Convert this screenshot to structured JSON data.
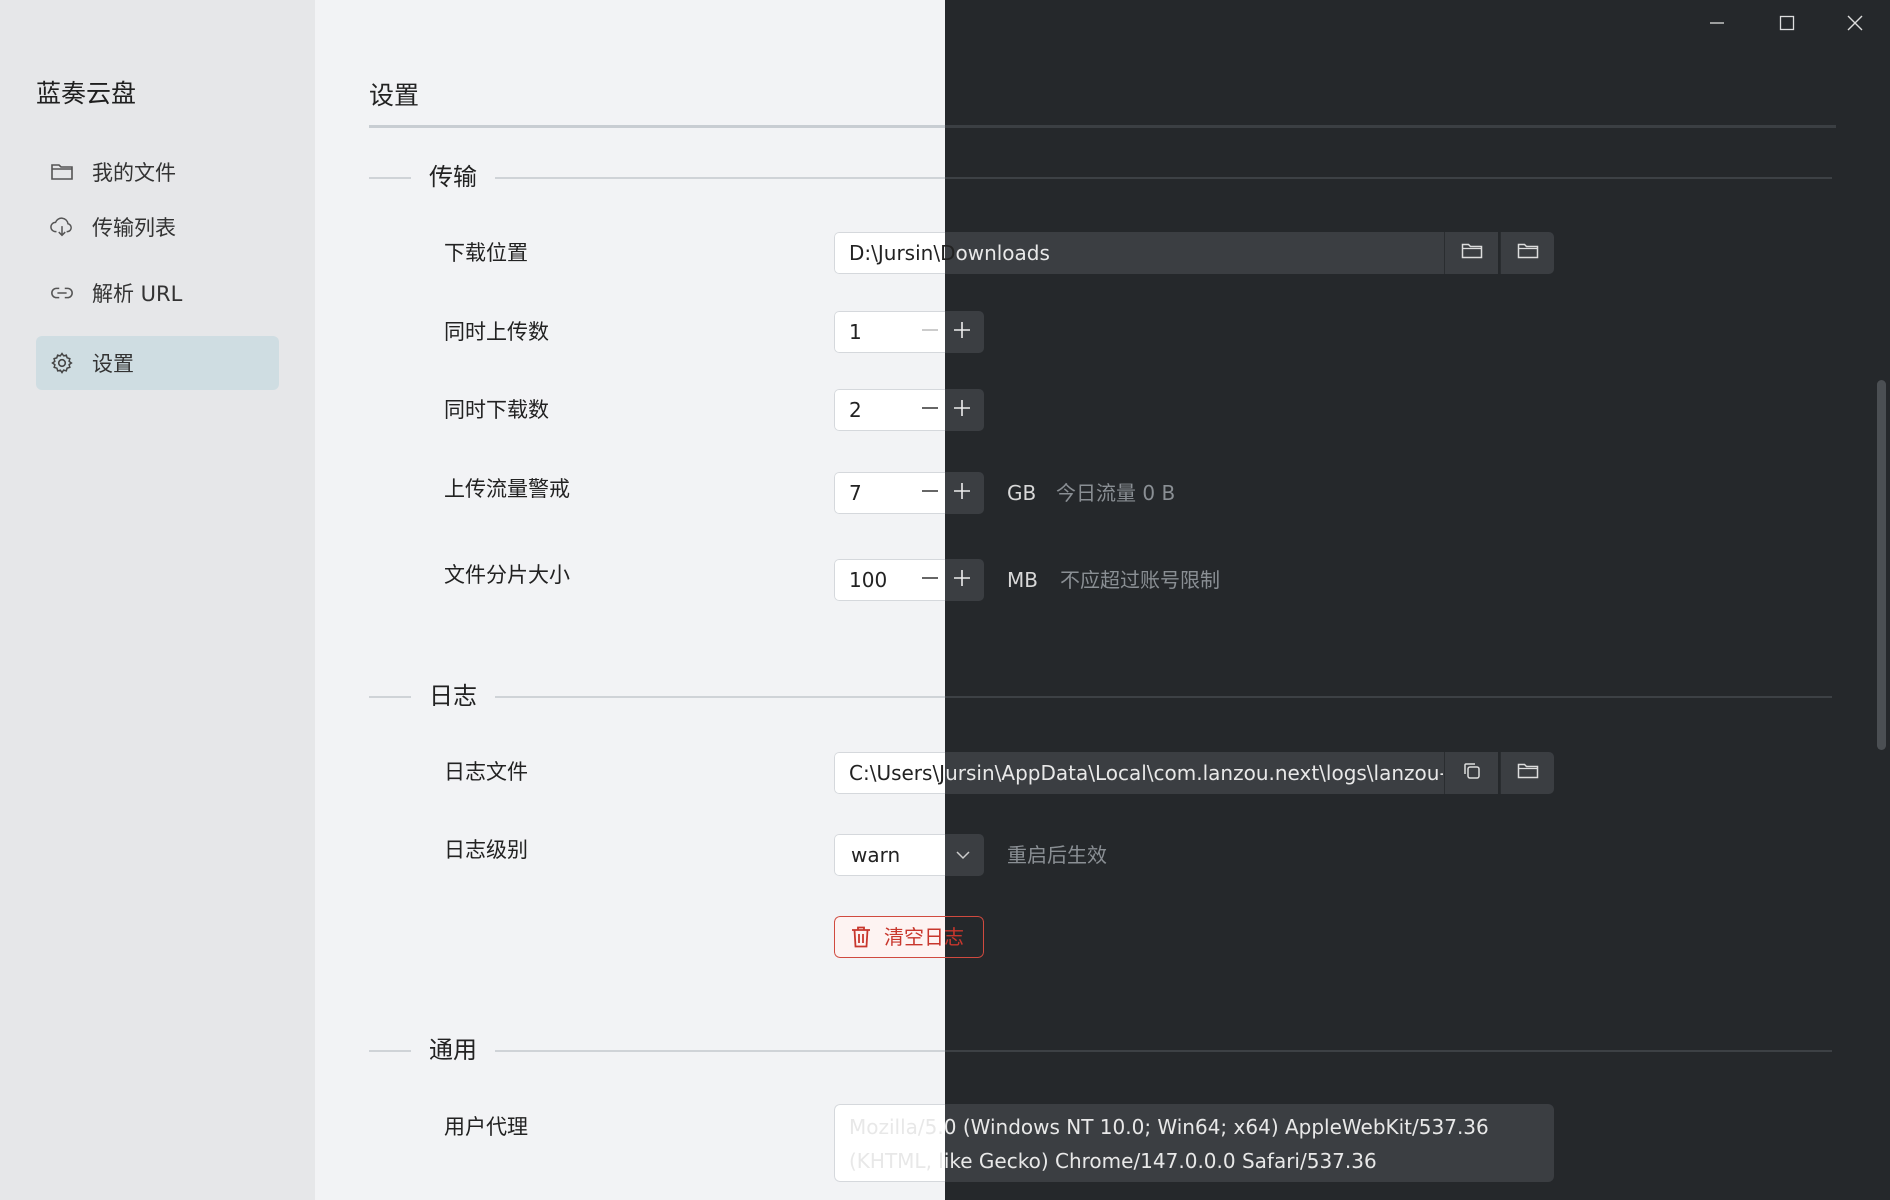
{
  "app": {
    "title": "蓝奏云盘"
  },
  "window_controls": {
    "minimize": "minimize-icon",
    "maximize": "maximize-icon",
    "close": "close-icon"
  },
  "sidebar": {
    "items": [
      {
        "label": "我的文件",
        "icon": "folder-icon",
        "active": false
      },
      {
        "label": "传输列表",
        "icon": "cloud-download-icon",
        "active": false
      },
      {
        "label": "解析 URL",
        "icon": "link-icon",
        "active": false
      },
      {
        "label": "设置",
        "icon": "gear-icon",
        "active": true
      }
    ]
  },
  "page": {
    "title": "设置"
  },
  "transfer": {
    "section_label": "传输",
    "download_location": {
      "label": "下载位置",
      "value_part1": "D:\\Jursin\\D",
      "value_part2": "ownloads"
    },
    "concurrent_uploads": {
      "label": "同时上传数",
      "value": "1"
    },
    "concurrent_downloads": {
      "label": "同时下载数",
      "value": "2"
    },
    "upload_traffic_alert": {
      "label": "上传流量警戒",
      "value": "7",
      "unit": "GB",
      "hint": "今日流量 0 B"
    },
    "chunk_size": {
      "label": "文件分片大小",
      "value": "100",
      "unit": "MB",
      "hint": "不应超过账号限制"
    }
  },
  "log": {
    "section_label": "日志",
    "log_file": {
      "label": "日志文件",
      "value_part1": "C:\\Users\\J",
      "value_part2": "ursin\\AppData\\Local\\com.lanzou.next\\logs\\lanzou-n"
    },
    "log_level": {
      "label": "日志级别",
      "value": "warn",
      "hint": "重启后生效"
    },
    "clear_button": "清空日志"
  },
  "general": {
    "section_label": "通用",
    "user_agent": {
      "label": "用户代理",
      "value": "Mozilla/5.0 (Windows NT 10.0; Win64; x64) AppleWebKit/537.36 (KHTML, like Gecko) Chrome/147.0.0.0 Safari/537.36"
    }
  },
  "colors": {
    "accent_active": "#cfdde2",
    "danger": "#c8372d",
    "dark_bg": "#25282b",
    "light_bg": "#f2f3f5"
  }
}
